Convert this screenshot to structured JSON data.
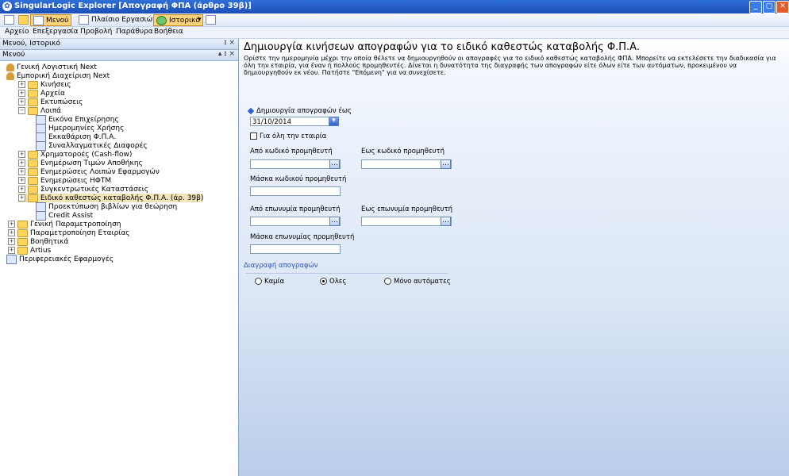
{
  "window": {
    "title": "SingularLogic Explorer [Απογραφή ΦΠΑ (άρθρο 39β)]",
    "minimize": "_",
    "maximize": "▢",
    "close": "✕"
  },
  "toolbar": {
    "menu_label": "Μενού",
    "window_frame_label": "Πλαίσιο Εργασιών",
    "history_label": "Ιστορικό",
    "dropdown_arrow": "▾"
  },
  "menubar": [
    "Αρχείο",
    "Επεξεργασία",
    "Προβολή",
    "Παράθυρα",
    "Βοήθεια"
  ],
  "left": {
    "top_header": "Μενού, Ιστορικό",
    "top_header_btns": "ɪ ×",
    "menu_header": "Μενού",
    "menu_header_btns": "▴ ɪ ×",
    "tree": [
      {
        "label": "Γενική Λογιστική Next",
        "icon": "user-icon",
        "expander": ""
      },
      {
        "label": "Εμπορική Διαχείριση Next",
        "icon": "user-icon",
        "expander": ""
      },
      {
        "label": "Κινήσεις",
        "icon": "folder-icon",
        "expander": "+"
      },
      {
        "label": "Αρχεία",
        "icon": "folder-icon",
        "expander": "+"
      },
      {
        "label": "Εκτυπώσεις",
        "icon": "folder-icon",
        "expander": "+"
      },
      {
        "label": "Λοιπά",
        "icon": "folder-icon",
        "expander": "−"
      },
      {
        "label": "Εικόνα Επιχείρησης",
        "icon": "house-icon",
        "expander": ""
      },
      {
        "label": "Ημερομηνίες Χρήσης",
        "icon": "calendar-icon",
        "expander": ""
      },
      {
        "label": "Εκκαθάριση Φ.Π.Α.",
        "icon": "grid-icon",
        "expander": ""
      },
      {
        "label": "Συναλλαγματικές Διαφορές",
        "icon": "sparkle-icon",
        "expander": ""
      },
      {
        "label": "Χρηματοροές (Cash-flow)",
        "icon": "folder-icon",
        "expander": "+"
      },
      {
        "label": "Ενημέρωση Τιμών Αποθήκης",
        "icon": "folder-icon",
        "expander": "+"
      },
      {
        "label": "Ενημερώσεις Λοιπών Εφαρμογών",
        "icon": "folder-icon",
        "expander": "+"
      },
      {
        "label": "Ενημερώσεις ΗΦΤΜ",
        "icon": "folder-icon",
        "expander": "+"
      },
      {
        "label": "Συγκεντρωτικές Καταστάσεις",
        "icon": "folder-icon",
        "expander": "+"
      },
      {
        "label": "Ειδικό καθεστώς καταβολής Φ.Π.Α. (άρ. 39β)",
        "icon": "folder-icon",
        "expander": "+",
        "selected": true
      },
      {
        "label": "Προεκτύπωση βιβλίων για θεώρηση",
        "icon": "printer-icon",
        "expander": ""
      },
      {
        "label": "Credit Assist",
        "icon": "credit-assist-icon",
        "expander": ""
      },
      {
        "label": "Γενική Παραμετροποίηση",
        "icon": "folder-icon",
        "expander": "+"
      },
      {
        "label": "Παραμετροποίηση Εταιρίας",
        "icon": "folder-icon",
        "expander": "+"
      },
      {
        "label": "Βοηθητικά",
        "icon": "folder-icon",
        "expander": "+"
      },
      {
        "label": "Artius",
        "icon": "folder-icon",
        "expander": "+"
      },
      {
        "label": "Περιφερειακές Εφαρμογές",
        "icon": "apps-icon",
        "expander": ""
      }
    ]
  },
  "main": {
    "title": "Δημιουργία κινήσεων απογραφών για το ειδικό καθεστώς καταβολής Φ.Π.Α.",
    "description": "Ορίστε την ημερομηνία μέχρι την οποία θέλετε να δημιουργηθούν οι απογραφές για το ειδικό καθεστώς καταβολής ΦΠΑ. Μπορείτε να εκτελέσετε την διαδικασία για όλη την εταιρία, για έναν ή πολλούς προμηθευτές. Δίνεται η δυνατότητα της διαγραφής των απογραφών είτε όλων είτε των αυτόματων, προκειμένου να δημιουργηθούν εκ νέου. Πατήστε \"Επόμενη\" για να συνεχίσετε.",
    "date_label": "Δημιουργία απογραφών έως",
    "date_value": "31/10/2014",
    "whole_company_label": "Για όλη την εταιρία",
    "from_code_label": "Από κωδικό προμηθευτή",
    "to_code_label": "Εως κωδικό προμηθευτή",
    "code_mask_label": "Μάσκα κωδικού προμηθευτή",
    "from_name_label": "Από επωνυμία προμηθευτή",
    "to_name_label": "Εως επωνυμία προμηθευτή",
    "name_mask_label": "Μάσκα επωνυμίας προμηθευτή",
    "lookup_btn": "…",
    "delete_group_label": "Διαγραφή απογραφών",
    "radio_none": "Καμία",
    "radio_all": "Ολες",
    "radio_auto": "Μόνο αυτόματες",
    "selected_radio": "all"
  }
}
